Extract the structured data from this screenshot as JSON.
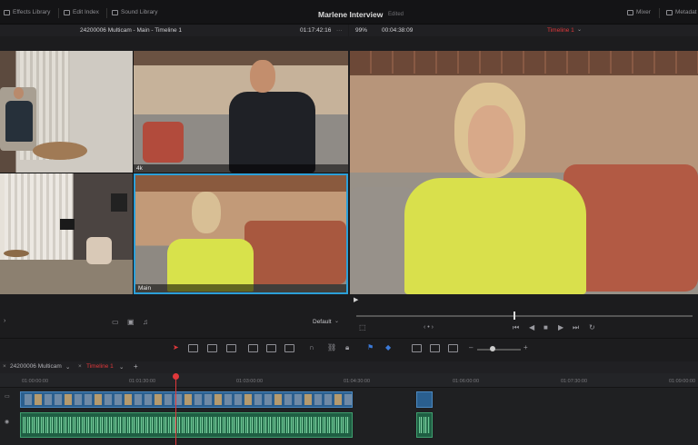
{
  "topbar": {
    "effects_library": "Effects Library",
    "edit_index": "Edit Index",
    "sound_library": "Sound Library",
    "project_title": "Marlene Interview",
    "project_state": "Edited",
    "mixer": "Mixer",
    "metadata": "Metadat"
  },
  "source_viewer": {
    "title": "24200006 Multicam - Main - Timeline 1",
    "timecode": "01:17:42:16",
    "more": "···"
  },
  "record_viewer": {
    "zoom": "99%",
    "duration": "00:04:38:09",
    "timeline_name": "Timeline 1"
  },
  "multicam": {
    "angles": [
      {
        "label": ""
      },
      {
        "label": "4k"
      },
      {
        "label": ""
      },
      {
        "label": "Main"
      }
    ],
    "preset": "Default"
  },
  "tabs": {
    "multicam_tab": "24200006 Multicam",
    "timeline_tab": "Timeline 1",
    "add": "+"
  },
  "ruler": {
    "labels": [
      "01:00:00:00",
      "01:01:30:00",
      "01:03:00:00",
      "01:04:30:00",
      "01:06:00:00",
      "01:07:30:00",
      "01:09:00:00"
    ]
  },
  "colors": {
    "accent_red": "#e0383b",
    "selected_border": "#2c9fd8",
    "video_clip": "#2a5f8f",
    "audio_clip": "#1f5e43"
  }
}
